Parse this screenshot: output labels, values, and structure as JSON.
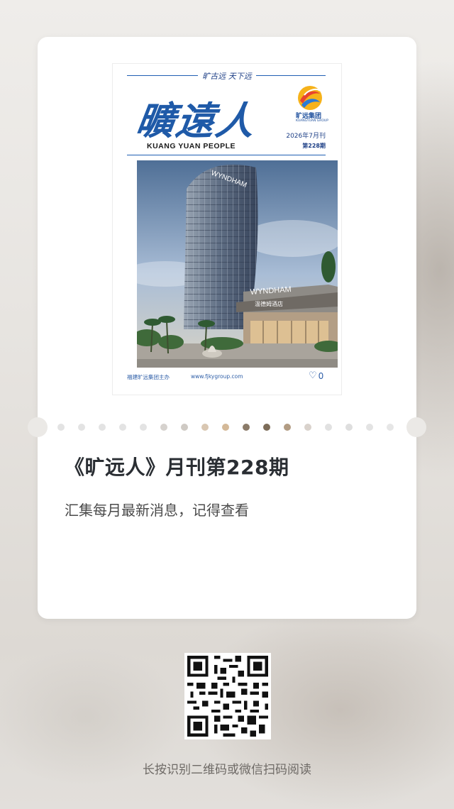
{
  "cover": {
    "slogan": "旷古远 天下远",
    "masthead": "曠遠人",
    "masthead_en": "KUANG YUAN PEOPLE",
    "group_logo_cn": "旷远集团",
    "group_logo_en": "KUANGYUAN GROUP",
    "issue_date": "2026年7月刊",
    "issue_number": "第228期",
    "photo_sign_top": "WYNDHAM",
    "photo_sign_entrance": "WYNDHAM",
    "photo_sign_cn": "温德姆酒店",
    "footer_sponsor": "福建旷远集团主办",
    "footer_url": "www.fjkygroup.com",
    "like_count": "0",
    "like_icon": "heart-outline-icon"
  },
  "article": {
    "title": "《旷远人》月刊第228期",
    "subtitle": "汇集每月最新消息，记得查看"
  },
  "qr": {
    "icon": "qr-code-icon"
  },
  "hint": "长按识别二维码或微信扫码阅读",
  "colors": {
    "brand_blue": "#1f5aa8",
    "perforation_dots": [
      "#e3e3e3",
      "#e3e3e3",
      "#e3e3e3",
      "#e3e3e3",
      "#e3e3e3",
      "#d6d2ce",
      "#cfcac4",
      "#d9c7b2",
      "#d4b998",
      "#8b7b69",
      "#7d6c59",
      "#b29c83",
      "#d9d2cc",
      "#e1e1e1",
      "#dedede",
      "#e3e3e3",
      "#e6e6e6"
    ]
  }
}
